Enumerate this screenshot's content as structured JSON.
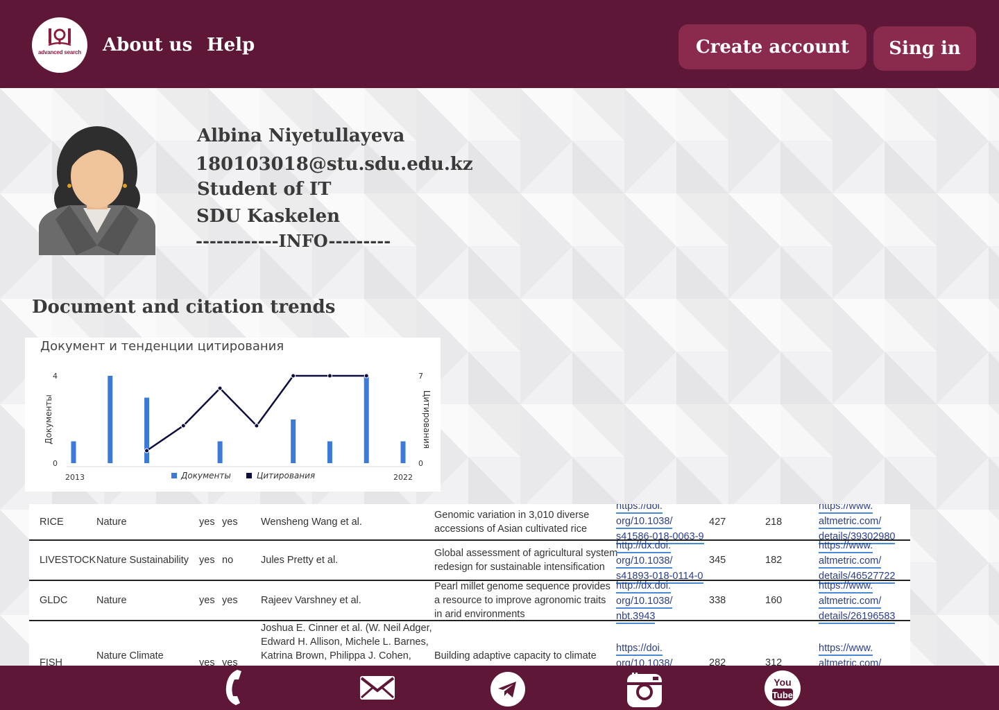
{
  "header": {
    "logo_text": "advanced search",
    "nav": [
      {
        "label": "About us"
      },
      {
        "label": "Help"
      }
    ],
    "create_account_label": "Create account",
    "sign_in_label": "Sing in"
  },
  "profile": {
    "name": "Albina Niyetullayeva",
    "email": "180103018@stu.sdu.edu.kz",
    "role": "Student of IT",
    "location": "SDU Kaskelen",
    "info_divider": "------------INFO---------"
  },
  "section_title": "Document and citation trends",
  "chart_data": {
    "type": "bar+line",
    "title": "Документ и тенденции цитирования",
    "ylabel_left": "Документы",
    "ylabel_right": "Цитирования",
    "x_start_label": "2013",
    "x_end_label": "2022",
    "y_left_ticks": [
      "0",
      "4"
    ],
    "y_right_ticks": [
      "0",
      "7"
    ],
    "ylim_left": [
      0,
      4
    ],
    "ylim_right": [
      0,
      7
    ],
    "x": [
      2013,
      2014,
      2015,
      2016,
      2017,
      2018,
      2019,
      2020,
      2021,
      2022
    ],
    "series": [
      {
        "name": "Документы",
        "type": "bar",
        "color": "#3b7ad9",
        "values": [
          1,
          4,
          3,
          0,
          1,
          0,
          2,
          1,
          4,
          1
        ]
      },
      {
        "name": "Цитирования",
        "type": "line",
        "color": "#0d0d3f",
        "values": [
          null,
          null,
          1,
          3,
          6,
          3,
          7,
          7,
          7,
          null
        ]
      }
    ],
    "legend": "bottom-center"
  },
  "table": {
    "rows": [
      {
        "crop": "RICE",
        "journal": [
          "Nature"
        ],
        "col3": "yes",
        "col4": "yes",
        "authors": [
          "Wensheng Wang et al."
        ],
        "title": [
          "Genomic variation in 3,010 diverse",
          "accessions of Asian cultivated rice"
        ],
        "doi": [
          "https://doi.",
          "org/10.1038/",
          "s41586-018-0063-9"
        ],
        "n1": "427",
        "n2": "218",
        "altmetric": [
          "https://www.",
          "altmetric.com/",
          "details/39302980"
        ]
      },
      {
        "crop": "LIVESTOCK",
        "journal": [
          "Nature Sustainability"
        ],
        "col3": "yes",
        "col4": "no",
        "authors": [
          "Jules Pretty et al."
        ],
        "title": [
          "Global assessment of agricultural system",
          "redesign for sustainable intensification"
        ],
        "doi": [
          "http://dx.doi.",
          "org/10.1038/",
          "s41893-018-0114-0"
        ],
        "n1": "345",
        "n2": "182",
        "altmetric": [
          "https://www.",
          "altmetric.com/",
          "details/46527722"
        ]
      },
      {
        "crop": "GLDC",
        "journal": [
          "Nature"
        ],
        "col3": "yes",
        "col4": "yes",
        "authors": [
          "Rajeev Varshney et al."
        ],
        "title": [
          "Pearl millet genome sequence provides",
          "a resource to improve agronomic traits",
          "in arid environments"
        ],
        "doi": [
          "http://dx.doi.",
          "org/10.1038/",
          "nbt.3943"
        ],
        "n1": "338",
        "n2": "160",
        "altmetric": [
          "https://www.",
          "altmetric.com/",
          "details/26196583"
        ]
      },
      {
        "crop": "FISH",
        "journal": [
          "Nature Climate"
        ],
        "col3": "yes",
        "col4": "yes",
        "authors": [
          "Joshua E. Cinner et al. (W. Neil Adger,",
          "Edward H. Allison, Michele L. Barnes,",
          "Katrina Brown, Philippa J. Cohen,"
        ],
        "title": [
          "Building adaptive capacity to climate"
        ],
        "doi": [
          "https://doi.",
          "org/10.1038/"
        ],
        "n1": "282",
        "n2": "312",
        "altmetric": [
          "https://www.",
          "altmetric.com/"
        ]
      }
    ]
  },
  "footer": {
    "icons": [
      "phone-icon",
      "mail-icon",
      "telegram-icon",
      "instagram-icon",
      "youtube-icon"
    ],
    "youtube_text_top": "You",
    "youtube_text_bottom": "Tube"
  }
}
